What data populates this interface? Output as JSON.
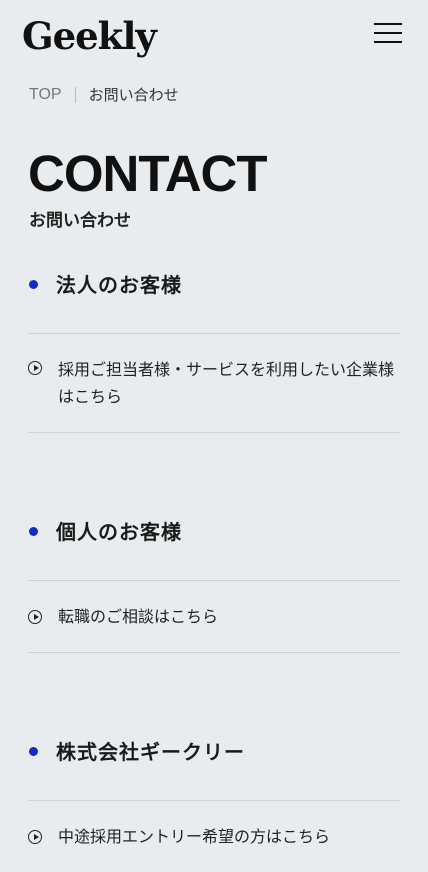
{
  "header": {
    "logo": "Geekly"
  },
  "breadcrumb": {
    "top": "TOP",
    "current": "お問い合わせ"
  },
  "page": {
    "title": "CONTACT",
    "subtitle": "お問い合わせ"
  },
  "sections": [
    {
      "title": "法人のお客様",
      "link": "採用ご担当者様・サービスを利用したい企業様はこちら"
    },
    {
      "title": "個人のお客様",
      "link": "転職のご相談はこちら"
    },
    {
      "title": "株式会社ギークリー",
      "link": "中途採用エントリー希望の方はこちら"
    }
  ],
  "colors": {
    "background": "#e9ecee",
    "accent_dot": "#1428c8"
  }
}
